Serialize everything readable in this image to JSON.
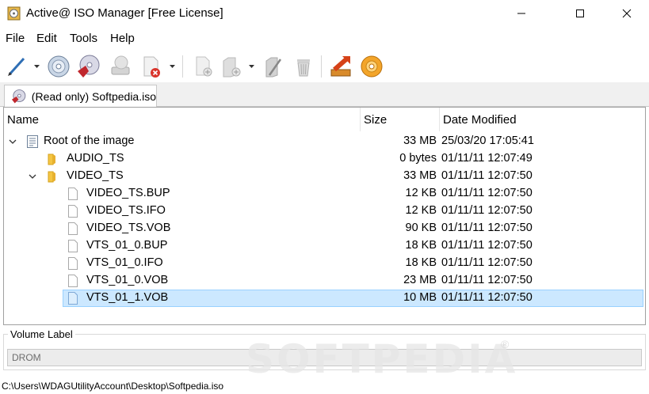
{
  "window": {
    "title": "Active@ ISO Manager [Free License]"
  },
  "menu": [
    "File",
    "Edit",
    "Tools",
    "Help"
  ],
  "toolbar": {
    "icons": [
      "new-image-icon",
      "open-image-icon",
      "burn-image-icon",
      "extract-icon",
      "close-image-icon",
      "add-file-icon",
      "add-folder-icon",
      "rename-icon",
      "delete-icon",
      "export-icon",
      "write-disc-icon"
    ]
  },
  "tab": {
    "label": "(Read only) Softpedia.iso"
  },
  "columns": {
    "name": "Name",
    "size": "Size",
    "date": "Date Modified"
  },
  "tree": [
    {
      "name": "Root of the image",
      "size": "33 MB",
      "date": "25/03/20 17:05:41",
      "type": "root",
      "depth": 0,
      "expanded": true
    },
    {
      "name": "AUDIO_TS",
      "size": "0 bytes",
      "date": "01/11/11 12:07:49",
      "type": "folder",
      "depth": 1
    },
    {
      "name": "VIDEO_TS",
      "size": "33 MB",
      "date": "01/11/11 12:07:50",
      "type": "folder",
      "depth": 1,
      "expanded": true
    },
    {
      "name": "VIDEO_TS.BUP",
      "size": "12 KB",
      "date": "01/11/11 12:07:50",
      "type": "file",
      "depth": 2
    },
    {
      "name": "VIDEO_TS.IFO",
      "size": "12 KB",
      "date": "01/11/11 12:07:50",
      "type": "file",
      "depth": 2
    },
    {
      "name": "VIDEO_TS.VOB",
      "size": "90 KB",
      "date": "01/11/11 12:07:50",
      "type": "file",
      "depth": 2
    },
    {
      "name": "VTS_01_0.BUP",
      "size": "18 KB",
      "date": "01/11/11 12:07:50",
      "type": "file",
      "depth": 2
    },
    {
      "name": "VTS_01_0.IFO",
      "size": "18 KB",
      "date": "01/11/11 12:07:50",
      "type": "file",
      "depth": 2
    },
    {
      "name": "VTS_01_0.VOB",
      "size": "23 MB",
      "date": "01/11/11 12:07:50",
      "type": "file",
      "depth": 2
    },
    {
      "name": "VTS_01_1.VOB",
      "size": "10 MB",
      "date": "01/11/11 12:07:50",
      "type": "file",
      "depth": 2,
      "selected": true
    }
  ],
  "volume": {
    "label": "Volume Label",
    "value": "DROM"
  },
  "status": {
    "path": "C:\\Users\\WDAGUtilityAccount\\Desktop\\Softpedia.iso"
  },
  "watermark": {
    "text": "SOFTPEDIA",
    "mark": "®"
  },
  "colors": {
    "selection": "#cce8ff",
    "selection_border": "#99d1ff",
    "folder": "#f5c542",
    "close_hover": "#e81123"
  }
}
